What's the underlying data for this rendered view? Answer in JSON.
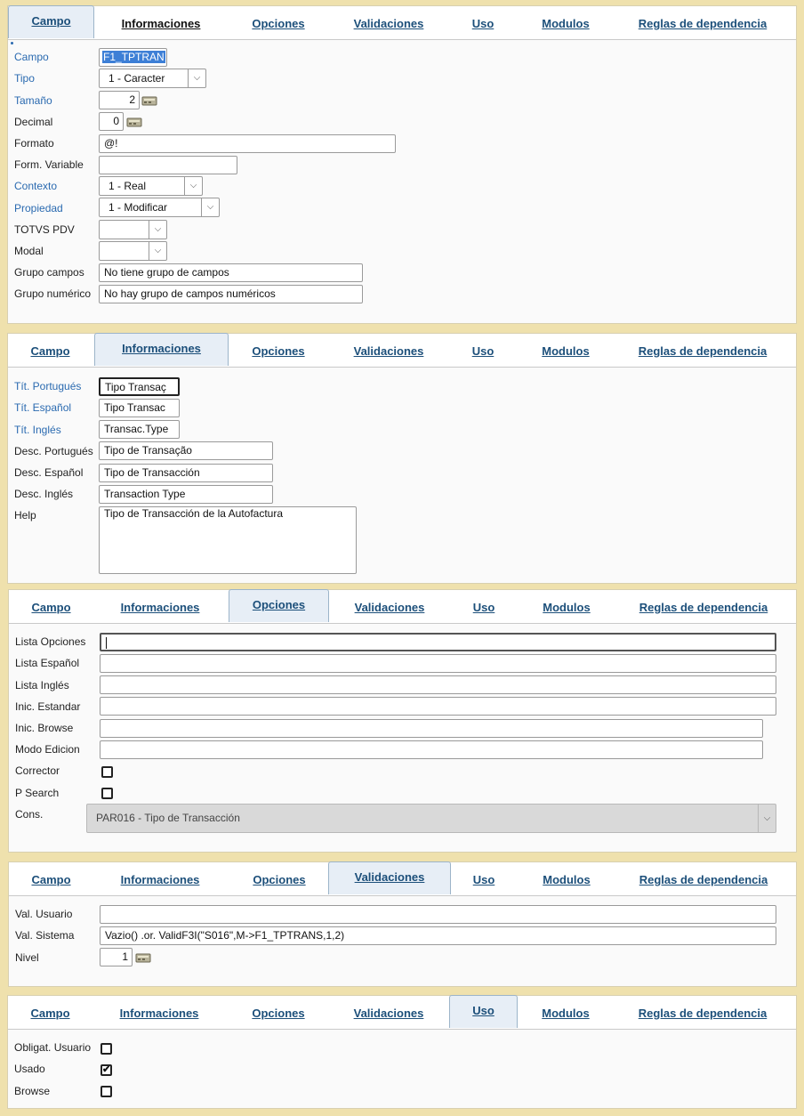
{
  "tabs": [
    "Campo",
    "Informaciones",
    "Opciones",
    "Validaciones",
    "Uso",
    "Modulos",
    "Reglas de dependencia"
  ],
  "campo": {
    "campo_label": "Campo",
    "campo_value": "F1_TPTRAN",
    "tipo_label": "Tipo",
    "tipo_value": "1 - Caracter",
    "tamano_label": "Tamaño",
    "tamano_value": "2",
    "decimal_label": "Decimal",
    "decimal_value": "0",
    "formato_label": "Formato",
    "formato_value": "@!",
    "form_variable_label": "Form. Variable",
    "form_variable_value": "",
    "contexto_label": "Contexto",
    "contexto_value": "1 - Real",
    "propiedad_label": "Propiedad",
    "propiedad_value": "1 - Modificar",
    "totvs_label": "TOTVS PDV",
    "totvs_value": "",
    "modal_label": "Modal",
    "modal_value": "",
    "grupo_campos_label": "Grupo campos",
    "grupo_campos_value": "No tiene grupo de campos",
    "grupo_numerico_label": "Grupo numérico",
    "grupo_numerico_value": "No hay grupo de campos numéricos"
  },
  "informaciones": {
    "tit_pt_label": "Tít. Portugués",
    "tit_pt_value": "Tipo Transaç",
    "tit_es_label": "Tít. Español",
    "tit_es_value": "Tipo Transac",
    "tit_en_label": "Tít. Inglés",
    "tit_en_value": "Transac.Type",
    "desc_pt_label": "Desc. Portugués",
    "desc_pt_value": "Tipo de Transação",
    "desc_es_label": "Desc. Español",
    "desc_es_value": "Tipo de Transacción",
    "desc_en_label": "Desc. Inglés",
    "desc_en_value": "Transaction Type",
    "help_label": "Help",
    "help_value": "Tipo de Transacción de la Autofactura"
  },
  "opciones": {
    "lista_opciones_label": "Lista Opciones",
    "lista_opciones_value": "",
    "lista_espanol_label": "Lista Español",
    "lista_espanol_value": "",
    "lista_ingles_label": "Lista Inglés",
    "lista_ingles_value": "",
    "inic_estandar_label": "Inic. Estandar",
    "inic_estandar_value": "",
    "inic_browse_label": "Inic. Browse",
    "inic_browse_value": "",
    "modo_edicion_label": "Modo Edicion",
    "modo_edicion_value": "",
    "corrector_label": "Corrector",
    "p_search_label": "P Search",
    "cons_label": "Cons.",
    "cons_value": "PAR016 - Tipo de Transacción"
  },
  "validaciones": {
    "val_usuario_label": "Val. Usuario",
    "val_usuario_value": "",
    "val_sistema_label": "Val. Sistema",
    "val_sistema_value": "Vazio() .or. ValidF3I(\"S016\",M->F1_TPTRANS,1,2)",
    "nivel_label": "Nivel",
    "nivel_value": "1"
  },
  "uso": {
    "obligat_label": "Obligat. Usuario",
    "obligat_checked": false,
    "usado_label": "Usado",
    "usado_checked": true,
    "browse_label": "Browse",
    "browse_checked": false
  },
  "colors": {
    "accent": "#1c4f7a",
    "blue_label": "#2a6ab0",
    "background": "#efe1ad"
  }
}
